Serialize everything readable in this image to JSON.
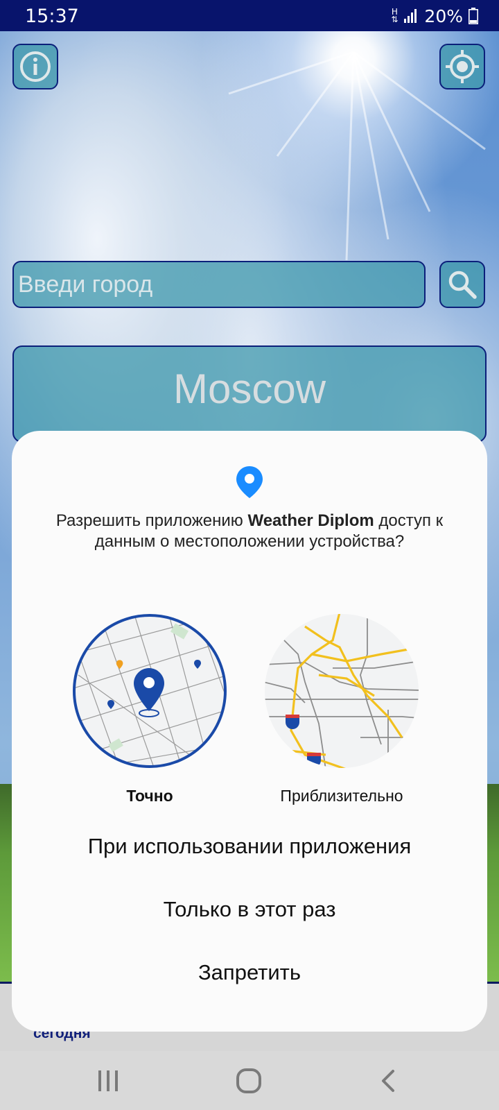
{
  "status_bar": {
    "time": "15:37",
    "network_type": "H",
    "battery_percent": "20%"
  },
  "app": {
    "info_button_icon": "info-icon",
    "locate_button_icon": "crosshair-icon",
    "search": {
      "placeholder": "Введи город",
      "value": ""
    },
    "search_button_icon": "search-icon",
    "city": "Moscow",
    "today_label": "сегодня"
  },
  "permission_dialog": {
    "icon": "location-pin-icon",
    "question_prefix": "Разрешить приложению ",
    "app_name": "Weather Diplom",
    "question_suffix": " доступ к данным о местоположении устройства?",
    "options": {
      "precise": "Точно",
      "approximate": "Приблизительно"
    },
    "buttons": {
      "while_using": "При использовании приложения",
      "only_this_time": "Только в этот раз",
      "deny": "Запретить"
    }
  },
  "navbar": {
    "recents_icon": "recents-icon",
    "home_icon": "home-icon",
    "back_icon": "back-icon"
  },
  "colors": {
    "status_bar": "#08146c",
    "accent_blue": "#1a4aa8",
    "pin_blue": "#1a8cff",
    "map_yellow": "#f2c01e"
  }
}
